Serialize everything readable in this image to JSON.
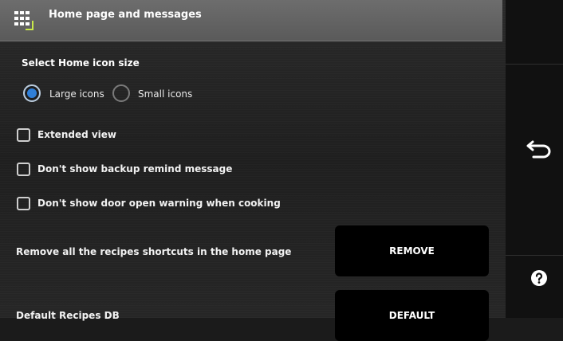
{
  "header": {
    "title": "Home page and messages",
    "icon": "grid-icon"
  },
  "icon_size": {
    "label": "Select Home icon size",
    "options": [
      {
        "label": "Large icons",
        "selected": true
      },
      {
        "label": "Small icons",
        "selected": false
      }
    ]
  },
  "checkboxes": [
    {
      "label": "Extended view",
      "checked": false
    },
    {
      "label": "Don't show backup remind message",
      "checked": false
    },
    {
      "label": "Don't show door open warning when cooking",
      "checked": false
    }
  ],
  "remove_shortcuts": {
    "label": "Remove all the recipes shortcuts in the home page",
    "button": "REMOVE"
  },
  "default_db": {
    "label": "Default Recipes DB",
    "button": "DEFAULT"
  },
  "sidebar": {
    "icons": [
      "back-arrow-icon",
      "help-icon"
    ]
  },
  "colors": {
    "accent": "#2f7fd8",
    "header": "#606060",
    "button": "#000000"
  }
}
